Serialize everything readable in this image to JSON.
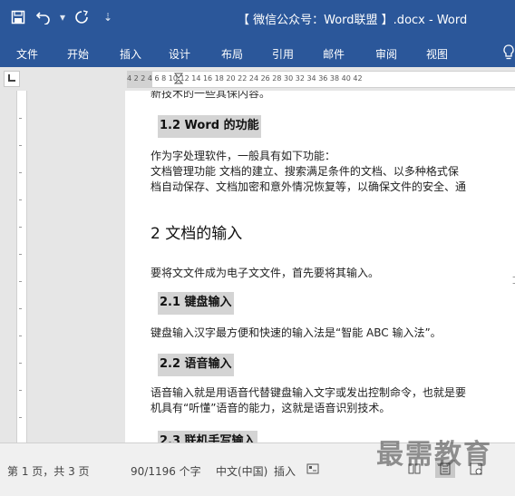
{
  "titlebar": {
    "save_icon": "save-icon",
    "undo_icon": "undo-icon",
    "redo_icon": "redo-icon",
    "customize_icon": "customize-qat-icon",
    "title": "【 微信公众号：Word联盟 】.docx - Word"
  },
  "tabs": [
    "文件",
    "开始",
    "插入",
    "设计",
    "布局",
    "引用",
    "邮件",
    "审阅",
    "视图"
  ],
  "ruler": {
    "numbers": "4  2      2  4  6  8  10  12  14  16  18  20  22  24  26  28  30  32  34  36  38  40  42"
  },
  "document": {
    "cut_top": "新技术的一些其保内容。",
    "h_1_2": "1.2 Word 的功能",
    "p1": "作为字处理软件，一般具有如下功能：",
    "p2": "文档管理功能   文档的建立、搜索满足条件的文档、以多种格式保",
    "p3": "档自动保存、文档加密和意外情况恢复等，以确保文件的安全、通",
    "h_2": "2 文档的输入",
    "p4": "要将文文件成为电子文文件，首先要将其输入。",
    "h_2_1": "2.1 键盘输入",
    "p5": "键盘输入汉字最方便和快速的输入法是“智能 ABC 输入法”。",
    "h_2_2": "2.2 语音输入",
    "p6": "语音输入就是用语音代替键盘输入文字或发出控制命令，也就是要",
    "p7": "机具有“听懂”语音的能力，这就是语音识别技术。",
    "h_2_3": "2.3 联机手写输入"
  },
  "status": {
    "page": "第 1 页，共 3 页",
    "words": "90/1196 个字",
    "lang": "中文(中国)",
    "mode": "插入",
    "macro_icon": "macro-record-icon",
    "view_read": "read-mode-icon",
    "view_print": "print-layout-icon",
    "view_web": "web-layout-icon"
  },
  "watermark": "最需教育",
  "colors": {
    "ribbon": "#2b579a",
    "highlight": "#d4d4d4"
  }
}
